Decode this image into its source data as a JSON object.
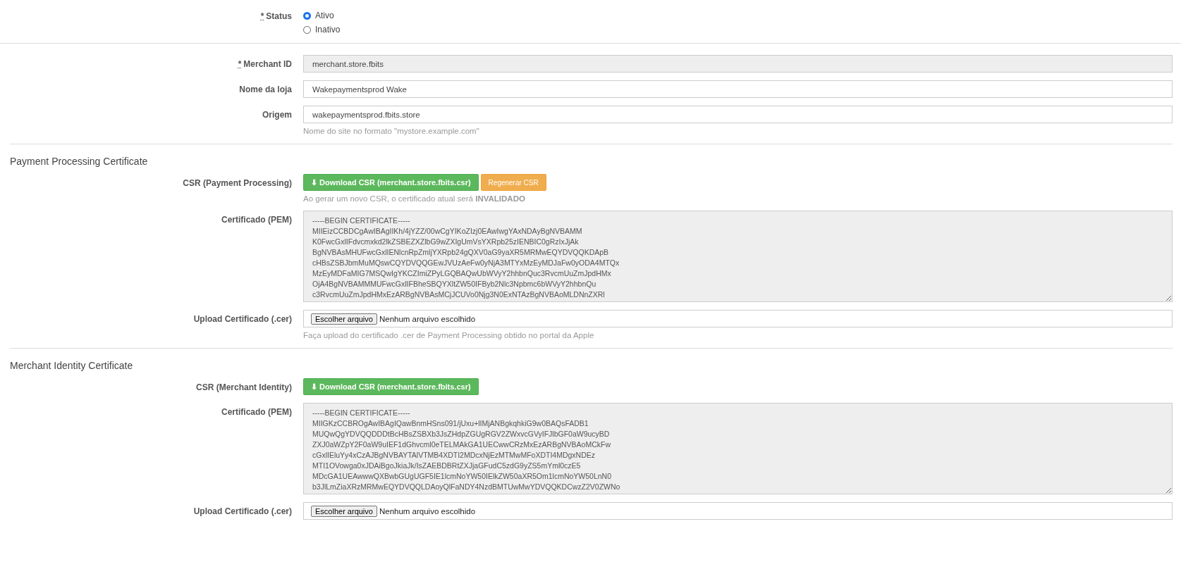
{
  "status": {
    "required_mark": "*",
    "label": "Status",
    "options": [
      {
        "label": "Ativo",
        "selected": true
      },
      {
        "label": "Inativo",
        "selected": false
      }
    ]
  },
  "fields": [
    {
      "required_mark": "*",
      "label": "Merchant ID",
      "value": "merchant.store.fbits",
      "disabled": true
    },
    {
      "label": "Nome da loja",
      "value": "Wakepaymentsprod Wake",
      "disabled": false
    },
    {
      "label": "Origem",
      "value": "wakepaymentsprod.fbits.store",
      "disabled": false,
      "help": "Nome do site no formato \"mystore.example.com\""
    }
  ],
  "sections": [
    {
      "title": "Payment Processing Certificate",
      "csr": {
        "label": "CSR (Payment Processing)",
        "buttons": [
          {
            "kind": "download",
            "label": "⬇ Download CSR (merchant.store.fbits.csr)"
          },
          {
            "kind": "regenerate",
            "label": "Regenerar CSR"
          }
        ],
        "help": "Ao gerar um novo CSR, o certificado atual será **INVALIDADO**"
      },
      "certificate": {
        "label": "Certificado (PEM)",
        "lines": [
          "-----BEGIN CERTIFICATE-----",
          "MIIEizCCBDCgAwIBAgIIKh/4jYZZ/00wCgYIKoZIzj0EAwIwgYAxNDAyBgNVBAMM",
          "K0FwcGxlIFdvcmxkd2lkZSBEZXZlbG9wZXIgUmVsYXRpb25zIENBIC0gRzIxJjAk",
          "BgNVBAsMHUFwcGxlIENlcnRpZmljYXRpb24gQXV0aG9yaXR5MRMwEQYDVQQKDApB",
          "cHBsZSBJbmMuMQswCQYDVQQGEwJVUzAeFw0yNjA3MTYxMzEyMDJaFw0yODA4MTQx",
          "MzEyMDFaMIG7MSQwIgYKCZImiZPyLGQBAQwUbWVyY2hhbnQuc3RvcmUuZmJpdHMx",
          "OjA4BgNVBAMMMUFwcGxlIFBheSBQYXltZW50IFByb2Nlc3Npbmc6bWVyY2hhbnQu",
          "c3RvcmUuZmJpdHMxEzARBgNVBAsMCjJCUVo0Njg3N0ExNTAzBgNVBAoMLDNnZXRl"
        ]
      },
      "upload": {
        "label": "Upload Certificado (.cer)",
        "button": "Escolher arquivo",
        "file": "Nenhum arquivo escolhido",
        "help": "Faça upload do certificado .cer de Payment Processing obtido no portal da Apple"
      }
    },
    {
      "title": "Merchant Identity Certificate",
      "csr": {
        "label": "CSR (Merchant Identity)",
        "buttons": [
          {
            "kind": "download",
            "label": "⬇ Download CSR (merchant.store.fbits.csr)"
          }
        ]
      },
      "certificate": {
        "label": "Certificado (PEM)",
        "lines": [
          "-----BEGIN CERTIFICATE-----",
          "MIIGKzCCBROgAwIBAgIQawBnmHSns091/jUxu+lIMjANBgkqhkiG9w0BAQsFADB1",
          "MUQwQgYDVQQDDDtBcHBsZSBXb3JsZHdpZGUgRGV2ZWxvcGVyIFJlbGF0aW9ucyBD",
          "ZXJ0aWZpY2F0aW9uIEF1dGhvcml0eTELMAkGA1UECwwCRzMxEzARBgNVBAoMCkFw",
          "cGxlIEluYy4xCzAJBgNVBAYTAlVTMB4XDTI2MDcxNjEzMTMwMFoXDTI4MDgxNDEz",
          "MTI1OVowga0xJDAiBgoJkiaJk/IsZAEBDBRtZXJjaGFudC5zdG9yZS5mYml0czE5",
          "MDcGA1UEAwwwQXBwbGUgUGF5IE1lcmNoYW50IElkZW50aXR5Om1lcmNoYW50LnN0",
          "b3JlLmZiaXRzMRMwEQYDVQQLDAoyQlFaNDY4NzdBMTUwMwYDVQQKDCwzZ2V0ZWNo"
        ]
      },
      "upload": {
        "label": "Upload Certificado (.cer)",
        "button": "Escolher arquivo",
        "file": "Nenhum arquivo escolhido"
      }
    }
  ]
}
